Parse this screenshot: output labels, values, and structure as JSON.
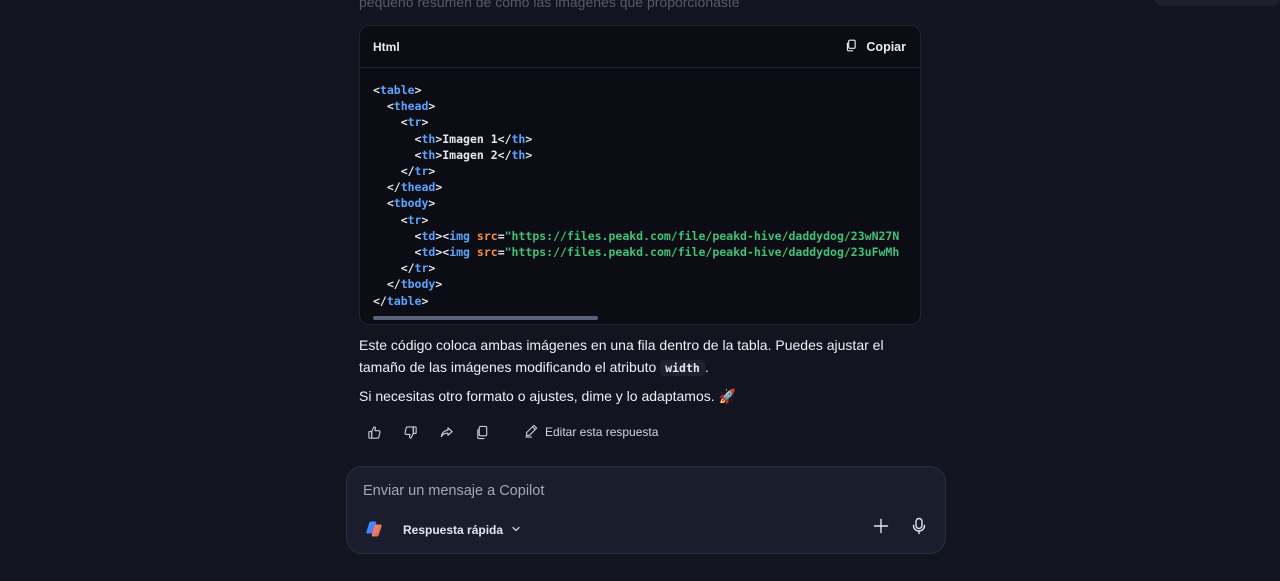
{
  "previous_text_fragment": "pequeño resumen de cómo las imágenes que proporcionaste",
  "code_block": {
    "language": "Html",
    "copy_label": "Copiar",
    "lines": [
      [
        {
          "t": "<",
          "c": "p"
        },
        {
          "t": "table",
          "c": "tag"
        },
        {
          "t": ">",
          "c": "p"
        }
      ],
      [
        {
          "t": "  <",
          "c": "p"
        },
        {
          "t": "thead",
          "c": "tag"
        },
        {
          "t": ">",
          "c": "p"
        }
      ],
      [
        {
          "t": "    <",
          "c": "p"
        },
        {
          "t": "tr",
          "c": "tag"
        },
        {
          "t": ">",
          "c": "p"
        }
      ],
      [
        {
          "t": "      <",
          "c": "p"
        },
        {
          "t": "th",
          "c": "tag"
        },
        {
          "t": ">Imagen 1</",
          "c": "p"
        },
        {
          "t": "th",
          "c": "tag"
        },
        {
          "t": ">",
          "c": "p"
        }
      ],
      [
        {
          "t": "      <",
          "c": "p"
        },
        {
          "t": "th",
          "c": "tag"
        },
        {
          "t": ">Imagen 2</",
          "c": "p"
        },
        {
          "t": "th",
          "c": "tag"
        },
        {
          "t": ">",
          "c": "p"
        }
      ],
      [
        {
          "t": "    </",
          "c": "p"
        },
        {
          "t": "tr",
          "c": "tag"
        },
        {
          "t": ">",
          "c": "p"
        }
      ],
      [
        {
          "t": "  </",
          "c": "p"
        },
        {
          "t": "thead",
          "c": "tag"
        },
        {
          "t": ">",
          "c": "p"
        }
      ],
      [
        {
          "t": "  <",
          "c": "p"
        },
        {
          "t": "tbody",
          "c": "tag"
        },
        {
          "t": ">",
          "c": "p"
        }
      ],
      [
        {
          "t": "    <",
          "c": "p"
        },
        {
          "t": "tr",
          "c": "tag"
        },
        {
          "t": ">",
          "c": "p"
        }
      ],
      [
        {
          "t": "      <",
          "c": "p"
        },
        {
          "t": "td",
          "c": "tag"
        },
        {
          "t": "><",
          "c": "p"
        },
        {
          "t": "img",
          "c": "tag"
        },
        {
          "t": " ",
          "c": "p"
        },
        {
          "t": "src",
          "c": "attr"
        },
        {
          "t": "=",
          "c": "p"
        },
        {
          "t": "\"https://files.peakd.com/file/peakd-hive/daddydog/23wN27N",
          "c": "str"
        }
      ],
      [
        {
          "t": "      <",
          "c": "p"
        },
        {
          "t": "td",
          "c": "tag"
        },
        {
          "t": "><",
          "c": "p"
        },
        {
          "t": "img",
          "c": "tag"
        },
        {
          "t": " ",
          "c": "p"
        },
        {
          "t": "src",
          "c": "attr"
        },
        {
          "t": "=",
          "c": "p"
        },
        {
          "t": "\"https://files.peakd.com/file/peakd-hive/daddydog/23uFwMh",
          "c": "str"
        }
      ],
      [
        {
          "t": "    </",
          "c": "p"
        },
        {
          "t": "tr",
          "c": "tag"
        },
        {
          "t": ">",
          "c": "p"
        }
      ],
      [
        {
          "t": "  </",
          "c": "p"
        },
        {
          "t": "tbody",
          "c": "tag"
        },
        {
          "t": ">",
          "c": "p"
        }
      ],
      [
        {
          "t": "</",
          "c": "p"
        },
        {
          "t": "table",
          "c": "tag"
        },
        {
          "t": ">",
          "c": "p"
        }
      ]
    ],
    "scroll_fraction": 0.41
  },
  "response": {
    "paragraph1_a": "Este código coloca ambas imágenes en una fila dentro de la tabla. Puedes ajustar el tamaño de las imágenes modificando el atributo",
    "paragraph1_code": "width",
    "paragraph1_b": ".",
    "paragraph2": "Si necesitas otro formato o ajustes, dime y lo adaptamos. 🚀"
  },
  "actions": {
    "like_icon": "thumbs-up-icon",
    "dislike_icon": "thumbs-down-icon",
    "share_icon": "share-icon",
    "copy_icon": "copy-icon",
    "edit_label": "Editar esta respuesta"
  },
  "composer": {
    "placeholder": "Enviar un mensaje a Copilot",
    "mode_label": "Respuesta rápida"
  },
  "colors": {
    "background": "#12141f",
    "code_bg": "#0b0c14",
    "tag": "#5aa5ff",
    "attr": "#f2904a",
    "string": "#3ec27a"
  }
}
